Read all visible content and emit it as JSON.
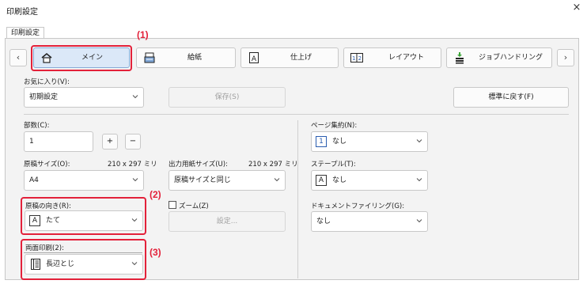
{
  "window": {
    "title": "印刷設定",
    "close_glyph": "×"
  },
  "tab": {
    "label": "印刷設定"
  },
  "nav": {
    "prev": "‹",
    "next": "›"
  },
  "main_tabs": [
    {
      "label": "メイン",
      "icon": "home-icon",
      "active": true
    },
    {
      "label": "給紙",
      "icon": "paper-tray-icon"
    },
    {
      "label": "仕上げ",
      "icon": "finishing-icon"
    },
    {
      "label": "レイアウト",
      "icon": "layout-icon"
    },
    {
      "label": "ジョブハンドリング",
      "icon": "job-handling-icon"
    }
  ],
  "favorites": {
    "label": "お気に入り(V):",
    "value": "初期設定",
    "save": "保存(S)",
    "reset": "標準に戻す(F)"
  },
  "copies": {
    "label": "部数(C):",
    "value": "1",
    "plus": "+",
    "minus": "−"
  },
  "original_size": {
    "label": "原稿サイズ(O):",
    "dims": "210 x 297 ミリ",
    "value": "A4"
  },
  "output_size": {
    "label": "出力用紙サイズ(U):",
    "dims": "210 x 297 ミリ",
    "value": "原稿サイズと同じ"
  },
  "orientation": {
    "label": "原稿の向き(R):",
    "value": "たて",
    "glyph": "A"
  },
  "zoom": {
    "label": "ズーム(Z)",
    "settings": "設定..."
  },
  "duplex": {
    "label": "両面印刷(2):",
    "value": "長辺とじ"
  },
  "n_up": {
    "label": "ページ集約(N):",
    "value": "なし",
    "glyph": "1"
  },
  "staple": {
    "label": "ステープル(T):",
    "value": "なし",
    "glyph": "A"
  },
  "doc_filing": {
    "label": "ドキュメントファイリング(G):",
    "value": "なし"
  },
  "annotations": [
    "(1)",
    "(2)",
    "(3)"
  ],
  "colors": {
    "highlight": "#e3213a",
    "active_tab": "#dbe8f8"
  }
}
